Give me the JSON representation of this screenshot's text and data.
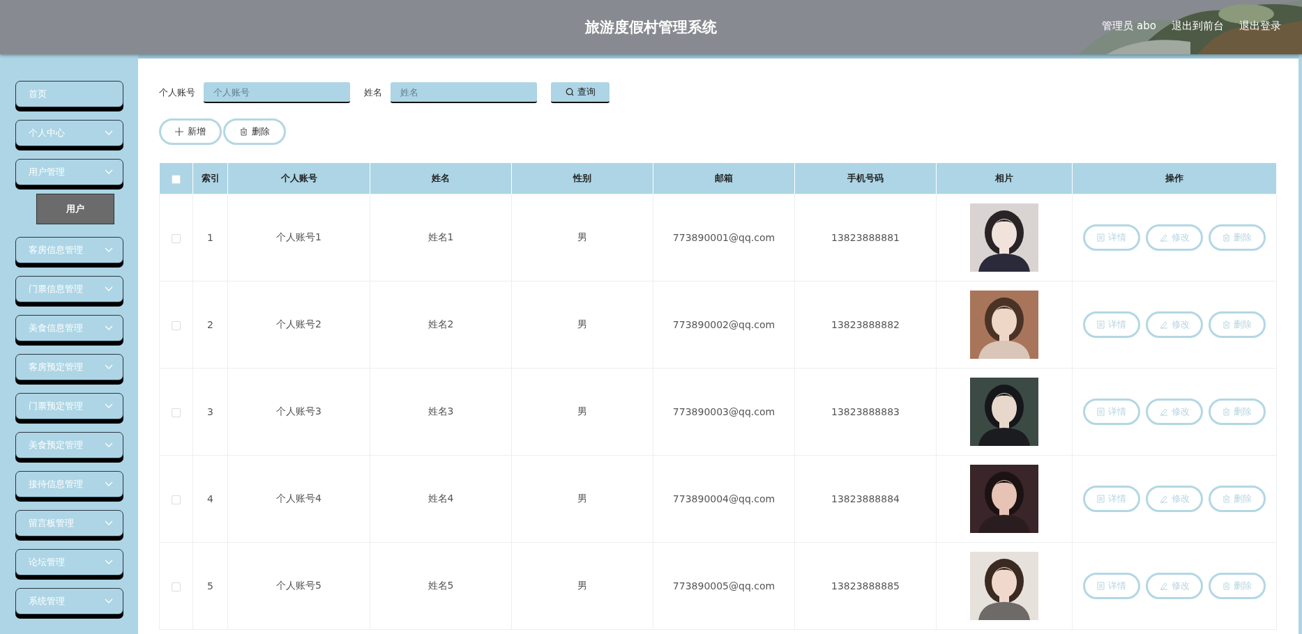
{
  "header": {
    "title": "旅游度假村管理系统",
    "user": "管理员 abo",
    "links": [
      "退出到前台",
      "退出登录"
    ]
  },
  "sidebar": {
    "items": [
      {
        "label": "首页",
        "kind": "link"
      },
      {
        "label": "个人中心",
        "kind": "menu"
      },
      {
        "label": "用户管理",
        "kind": "menu",
        "children": [
          {
            "label": "用户",
            "selected": true
          }
        ]
      },
      {
        "label": "客房信息管理",
        "kind": "menu"
      },
      {
        "label": "门票信息管理",
        "kind": "menu"
      },
      {
        "label": "美食信息管理",
        "kind": "menu"
      },
      {
        "label": "客房预定管理",
        "kind": "menu"
      },
      {
        "label": "门票预定管理",
        "kind": "menu"
      },
      {
        "label": "美食预定管理",
        "kind": "menu"
      },
      {
        "label": "接待信息管理",
        "kind": "menu"
      },
      {
        "label": "留言板管理",
        "kind": "menu"
      },
      {
        "label": "论坛管理",
        "kind": "menu"
      },
      {
        "label": "系统管理",
        "kind": "menu"
      }
    ]
  },
  "search": {
    "fields": [
      {
        "label": "个人账号",
        "placeholder": "个人账号"
      },
      {
        "label": "姓名",
        "placeholder": "姓名"
      }
    ],
    "button": "查询"
  },
  "actions": [
    "新增",
    "删除"
  ],
  "table": {
    "select_all_checked": false,
    "columns": [
      "索引",
      "个人账号",
      "姓名",
      "性别",
      "邮箱",
      "手机号码",
      "相片",
      "操作"
    ],
    "rows": [
      {
        "checked": false,
        "index": "1",
        "account": "个人账号1",
        "name": "姓名1",
        "gender": "男",
        "email": "773890001@qq.com",
        "phone": "13823888881",
        "actions": [
          "详情",
          "修改",
          "删除"
        ]
      },
      {
        "checked": false,
        "index": "2",
        "account": "个人账号2",
        "name": "姓名2",
        "gender": "男",
        "email": "773890002@qq.com",
        "phone": "13823888882",
        "actions": [
          "详情",
          "修改",
          "删除"
        ]
      },
      {
        "checked": false,
        "index": "3",
        "account": "个人账号3",
        "name": "姓名3",
        "gender": "男",
        "email": "773890003@qq.com",
        "phone": "13823888883",
        "actions": [
          "详情",
          "修改",
          "删除"
        ]
      },
      {
        "checked": false,
        "index": "4",
        "account": "个人账号4",
        "name": "姓名4",
        "gender": "男",
        "email": "773890004@qq.com",
        "phone": "13823888884",
        "actions": [
          "详情",
          "修改",
          "删除"
        ]
      },
      {
        "checked": false,
        "index": "5",
        "account": "个人账号5",
        "name": "姓名5",
        "gender": "男",
        "email": "773890005@qq.com",
        "phone": "13823888885",
        "actions": [
          "详情",
          "修改",
          "删除"
        ]
      }
    ]
  }
}
